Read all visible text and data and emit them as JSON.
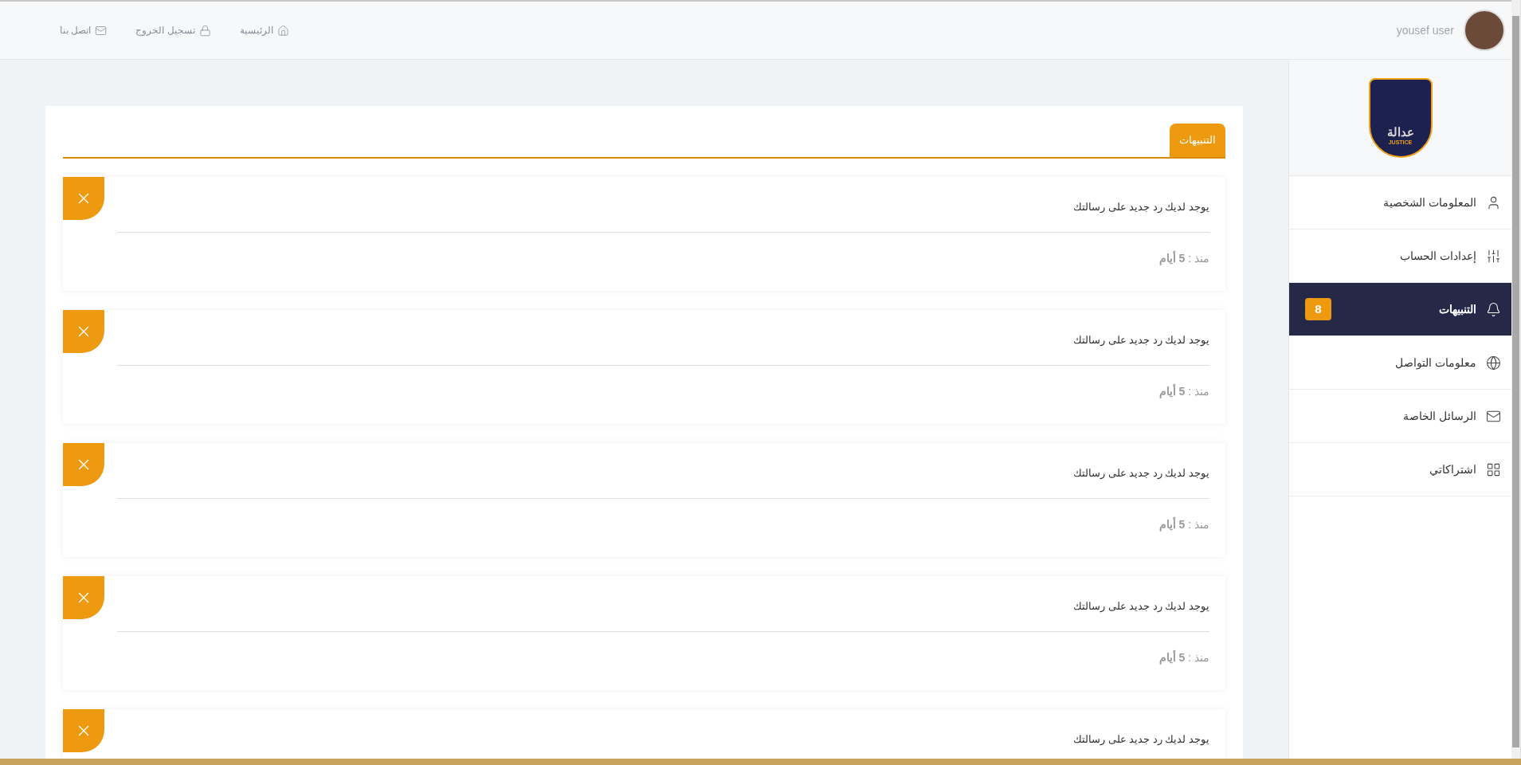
{
  "header": {
    "user_name": "yousef user",
    "nav": [
      {
        "label": "الرئيسية",
        "kind": "home"
      },
      {
        "label": "تسجيل الخروج",
        "kind": "logout"
      },
      {
        "label": "اتصل بنا",
        "kind": "contact"
      }
    ]
  },
  "logo": {
    "name": "عدالة",
    "tagline": "JUSTICE"
  },
  "sidebar": {
    "items": [
      {
        "label": "المعلومات الشخصية",
        "kind": "profile",
        "selected": false
      },
      {
        "label": "إعدادات الحساب",
        "kind": "settings",
        "selected": false
      },
      {
        "label": "التنبيهات",
        "kind": "alerts",
        "selected": true,
        "badge": "8"
      },
      {
        "label": "معلومات التواصل",
        "kind": "contact",
        "selected": false
      },
      {
        "label": "الرسائل الخاصة",
        "kind": "messages",
        "selected": false
      },
      {
        "label": "اشتراكاتي",
        "kind": "subscriptions",
        "selected": false
      }
    ]
  },
  "tabs": [
    {
      "label": "التنبيهات",
      "selected": true
    }
  ],
  "notifications": [
    {
      "message": "يوجد لديك رد جديد على رسالتك",
      "time": "منذ : **5 أيام**"
    },
    {
      "message": "يوجد لديك رد جديد على رسالتك",
      "time": "منذ : **5 أيام**"
    },
    {
      "message": "يوجد لديك رد جديد على رسالتك",
      "time": "منذ : **5 أيام**"
    },
    {
      "message": "يوجد لديك رد جديد على رسالتك",
      "time": "منذ : **5 أيام**"
    },
    {
      "message": "يوجد لديك رد جديد على رسالتك"
    }
  ]
}
